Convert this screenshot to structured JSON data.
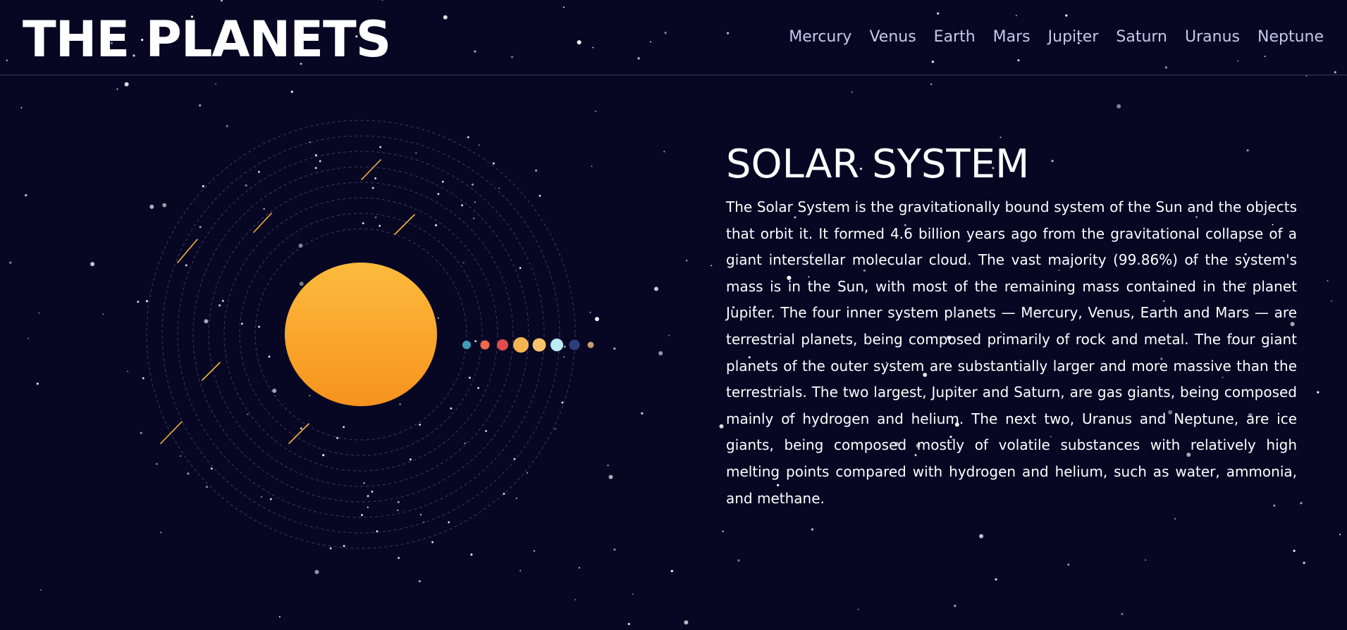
{
  "header": {
    "logo": "THE PLANETS",
    "nav": [
      "Mercury",
      "Venus",
      "Earth",
      "Mars",
      "Jupiter",
      "Saturn",
      "Uranus",
      "Neptune"
    ]
  },
  "main": {
    "title": "SOLAR SYSTEM",
    "description": "The Solar System is the gravitationally bound system of the Sun and the objects that orbit it. It formed 4.6 billion years ago from the gravitational collapse of a giant interstellar molecular cloud. The vast majority (99.86%) of the system's mass is in the Sun, with most of the remaining mass contained in the planet Jupiter. The four inner system planets — Mercury, Venus, Earth and Mars — are terrestrial planets, being composed primarily of rock and metal. The four giant planets of the outer system are substantially larger and more massive than the terrestrials. The two largest, Jupiter and Saturn, are gas giants, being composed mainly of hydrogen and helium. The next two, Uranus and Neptune, are ice giants, being composed mostly of volatile substances with relatively high melting points compared with hydrogen and helium, such as water, ammonia, and methane."
  },
  "illustration": {
    "sun_color_top": "#fcbb3c",
    "sun_color_bottom": "#f6921e",
    "orbit_count": 8,
    "planets": [
      {
        "name": "Mercury",
        "color": "#419ebb"
      },
      {
        "name": "Venus",
        "color": "#ed6a4b"
      },
      {
        "name": "Earth",
        "color": "#e24b4b"
      },
      {
        "name": "Mars",
        "color": "#f4b44f"
      },
      {
        "name": "Jupiter",
        "color": "#f7c36b"
      },
      {
        "name": "Saturn",
        "color": "#b9ecf5"
      },
      {
        "name": "Uranus",
        "color": "#2d3f7a"
      },
      {
        "name": "Neptune",
        "color": "#c89b72"
      }
    ]
  },
  "colors": {
    "background": "#070724",
    "nav_text": "#c5c9e8",
    "meteor": "#f5b335"
  }
}
